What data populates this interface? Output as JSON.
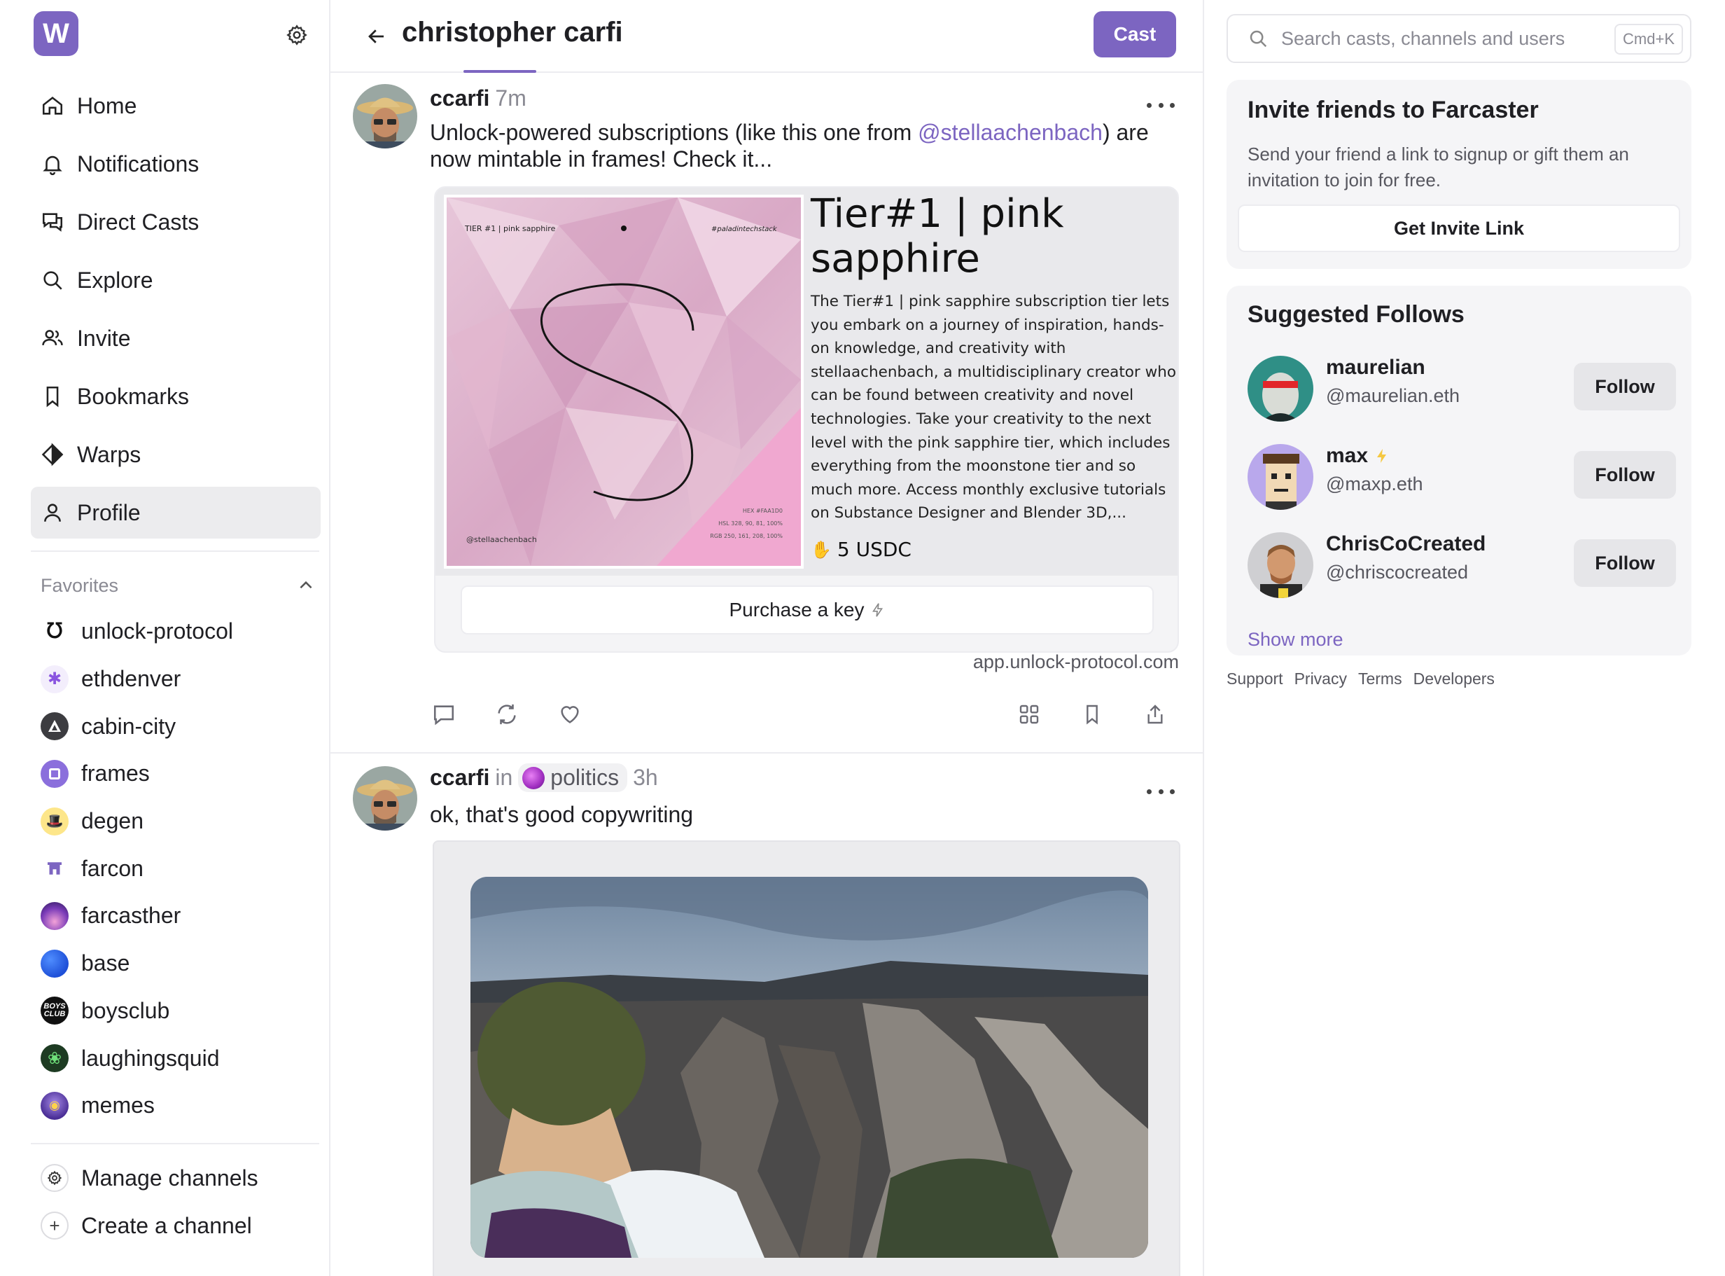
{
  "app": {
    "logo_letter": "W",
    "accent": "#7c65c1"
  },
  "sidebar": {
    "nav": [
      {
        "label": "Home",
        "icon": "home-icon"
      },
      {
        "label": "Notifications",
        "icon": "bell-icon"
      },
      {
        "label": "Direct Casts",
        "icon": "chat-icon"
      },
      {
        "label": "Explore",
        "icon": "search-icon"
      },
      {
        "label": "Invite",
        "icon": "users-icon"
      },
      {
        "label": "Bookmarks",
        "icon": "bookmark-icon"
      },
      {
        "label": "Warps",
        "icon": "diamond-icon"
      },
      {
        "label": "Profile",
        "icon": "user-icon",
        "active": true
      }
    ],
    "favorites_label": "Favorites",
    "favorites": [
      "unlock-protocol",
      "ethdenver",
      "cabin-city",
      "frames",
      "degen",
      "farcon",
      "farcasther",
      "base",
      "boysclub",
      "laughingsquid",
      "memes"
    ],
    "manage_channels": "Manage channels",
    "create_channel": "Create a channel"
  },
  "header": {
    "title": "christopher carfi",
    "cast_button": "Cast"
  },
  "casts": [
    {
      "user": "ccarfi",
      "time": "7m",
      "text_before": "Unlock-powered subscriptions (like this one from ",
      "mention": "@stellaachenbach",
      "text_after": ") are now mintable in frames! Check it...",
      "frame": {
        "title": "Tier#1 | pink sapphire",
        "description": "The Tier#1 | pink sapphire subscription tier lets you embark on a journey of inspiration, hands-on knowledge, and creativity with stellaachenbach, a multidisciplinary creator who can be found between creativity and novel technologies. Take your creativity to the next level with the pink sapphire tier, which includes everything from the moonstone tier and so much more. Access monthly exclusive tutorials on Substance Designer and Blender 3D,...",
        "price": "5 USDC",
        "button": "Purchase a key",
        "domain": "app.unlock-protocol.com",
        "nft": {
          "top_left": "TIER #1 | pink sapphire",
          "top_right": "#paladintechstack",
          "bottom_left": "@stellaachenbach",
          "hex": "HEX #FAA1D0",
          "hsl": "HSL 328, 90, 81, 100%",
          "rgb": "RGB 250, 161, 208, 100%"
        }
      }
    },
    {
      "user": "ccarfi",
      "in": "in",
      "channel": "politics",
      "time": "3h",
      "text": "ok, that's good copywriting"
    }
  ],
  "search": {
    "placeholder": "Search casts, channels and users",
    "shortcut": "Cmd+K"
  },
  "invite": {
    "title": "Invite friends to Farcaster",
    "text": "Send your friend a link to signup or gift them an invitation to join for free.",
    "button": "Get Invite Link"
  },
  "suggested": {
    "title": "Suggested Follows",
    "users": [
      {
        "name": "maurelian",
        "handle": "@maurelian.eth",
        "button": "Follow"
      },
      {
        "name": "max",
        "handle": "@maxp.eth",
        "button": "Follow",
        "badge": "lightning-icon"
      },
      {
        "name": "ChrisCoCreated",
        "handle": "@chriscocreated",
        "button": "Follow"
      }
    ],
    "show_more": "Show more"
  },
  "footer": [
    "Support",
    "Privacy",
    "Terms",
    "Developers"
  ]
}
